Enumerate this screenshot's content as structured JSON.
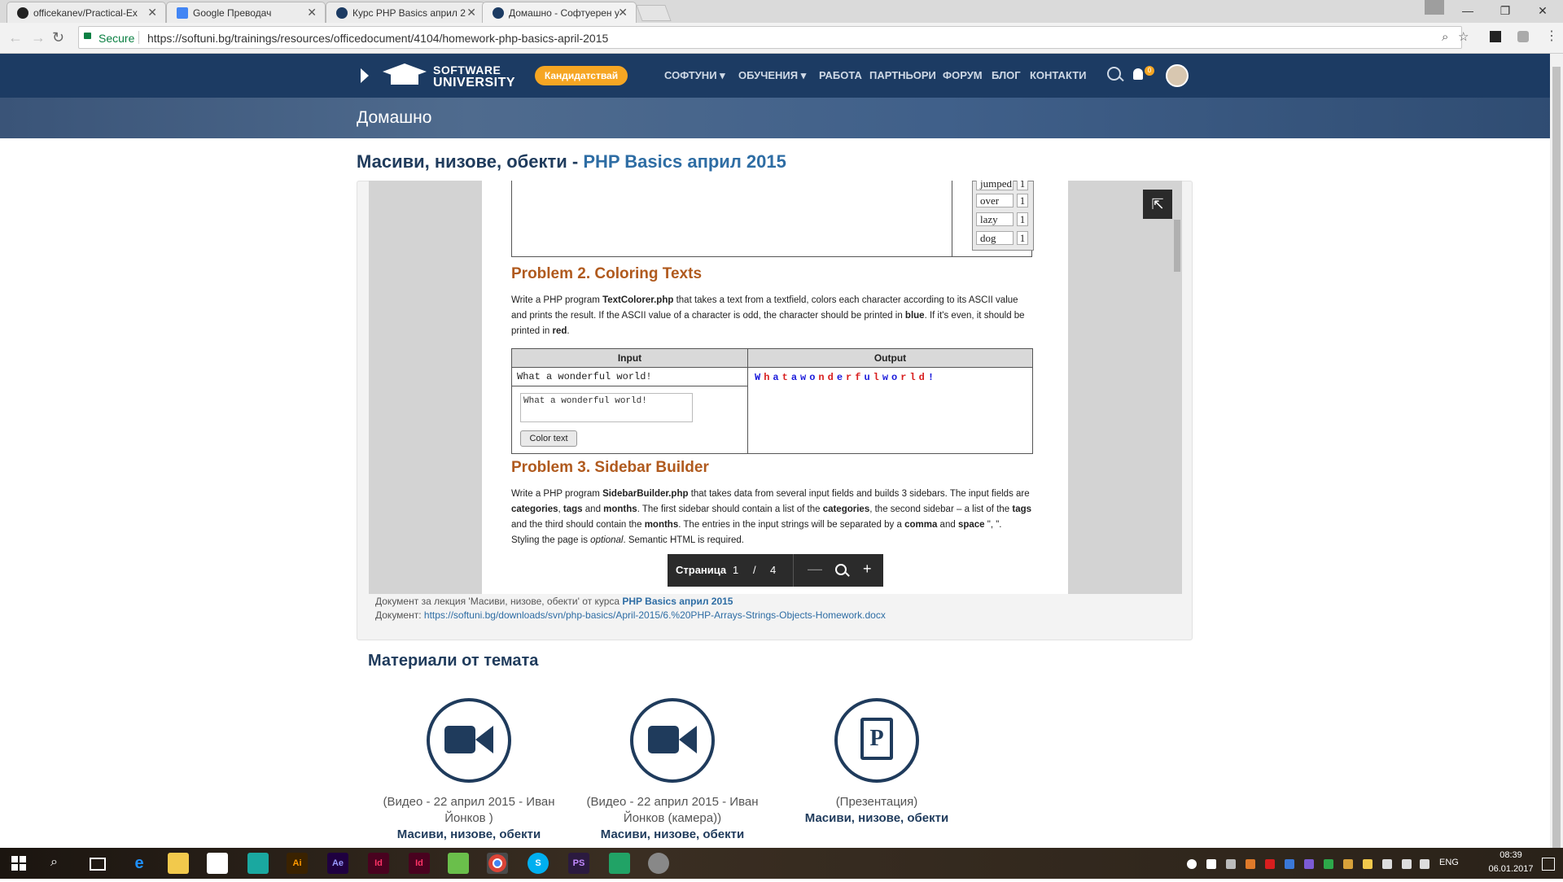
{
  "browser": {
    "tabs": [
      {
        "title": "officekanev/Practical-Ex",
        "icon_color": "#222222"
      },
      {
        "title": "Google Преводач",
        "icon_color": "#4285f4"
      },
      {
        "title": "Курс PHP Basics април 2",
        "icon_color": "#1c3b63"
      },
      {
        "title": "Домашно - Софтуерен у",
        "icon_color": "#1c3b63"
      }
    ],
    "secure_label": "Secure",
    "url": "https://softuni.bg/trainings/resources/officedocument/4104/homework-php-basics-april-2015"
  },
  "site": {
    "logo_line1": "SOFTWARE",
    "logo_line2": "UNIVERSITY",
    "apply_label": "Кандидатствай",
    "nav": [
      "СОФТУНИ",
      "ОБУЧЕНИЯ",
      "РАБОТА",
      "ПАРТНЬОРИ",
      "ФОРУМ",
      "БЛОГ",
      "КОНТАКТИ"
    ],
    "notification_count": "0",
    "hero_title": "Домашно",
    "brand_color": "#1c3b63",
    "accent_color": "#f6a623"
  },
  "heading": {
    "prefix": "Масиви, низове, обекти - ",
    "course": "PHP Basics април 2015"
  },
  "document": {
    "word_table": [
      {
        "word": "jumped",
        "count": "1"
      },
      {
        "word": "over",
        "count": "1"
      },
      {
        "word": "lazy",
        "count": "1"
      },
      {
        "word": "dog",
        "count": "1"
      }
    ],
    "problem2_title": "Problem 2.   Coloring Texts",
    "problem2_text_html": "Write a PHP program <b>TextColorer.php</b> that takes a text from a textfield, colors each character according to its ASCII value and prints the result. If the ASCII value of a character is odd, the character should be printed in <b>blue</b>. If it's even, it should be printed in <b>red</b>.",
    "io_input_header": "Input",
    "io_output_header": "Output",
    "io_input_value": "What a wonderful world!",
    "io_textarea_value": "What a wonderful world!",
    "io_button_label": "Color text",
    "io_output_chars": [
      {
        "ch": "W",
        "color": "#1a1adb"
      },
      {
        "ch": "h",
        "color": "#d81e1e"
      },
      {
        "ch": "a",
        "color": "#1a1adb"
      },
      {
        "ch": "t",
        "color": "#d81e1e"
      },
      {
        "ch": "a",
        "color": "#1a1adb"
      },
      {
        "ch": "w",
        "color": "#1a1adb"
      },
      {
        "ch": "o",
        "color": "#1a1adb"
      },
      {
        "ch": "n",
        "color": "#d81e1e"
      },
      {
        "ch": "d",
        "color": "#d81e1e"
      },
      {
        "ch": "e",
        "color": "#1a1adb"
      },
      {
        "ch": "r",
        "color": "#d81e1e"
      },
      {
        "ch": "f",
        "color": "#d81e1e"
      },
      {
        "ch": "u",
        "color": "#1a1adb"
      },
      {
        "ch": "l",
        "color": "#d81e1e"
      },
      {
        "ch": "w",
        "color": "#1a1adb"
      },
      {
        "ch": "o",
        "color": "#1a1adb"
      },
      {
        "ch": "r",
        "color": "#d81e1e"
      },
      {
        "ch": "l",
        "color": "#d81e1e"
      },
      {
        "ch": "d",
        "color": "#d81e1e"
      },
      {
        "ch": "!",
        "color": "#1a1adb"
      }
    ],
    "problem3_title": "Problem 3.   Sidebar Builder",
    "problem3_text_html": "Write a PHP program <b>SidebarBuilder.php</b> that takes data from several input fields and builds 3 sidebars. The input fields are <b>categories</b>, <b>tags</b> and <b>months</b>. The first sidebar should contain a list of the <b>categories</b>, the second sidebar – a list of the <b>tags</b> and the third should contain the <b>months</b>. The entries in the input strings will be separated by a <b>comma</b> and <b>space</b> \", \". Styling the page is <i>optional</i>. Semantic HTML is required."
  },
  "pager": {
    "label": "Страница",
    "current": "1",
    "separator": "/",
    "total": "4"
  },
  "caption": {
    "lecture_prefix": "Документ за лекция 'Масиви, низове, обекти' от курса ",
    "lecture_course": "PHP Basics април 2015",
    "doc_prefix": "Документ: ",
    "doc_url": "https://softuni.bg/downloads/svn/php-basics/April-2015/6.%20PHP-Arrays-Strings-Objects-Homework.docx"
  },
  "materials": {
    "heading": "Материали от темата",
    "items": [
      {
        "icon": "video-camera-icon",
        "desc": "(Видео - 22 април 2015 - Иван Йонков )",
        "title": "Масиви, низове, обекти"
      },
      {
        "icon": "video-camera-icon",
        "desc": "(Видео - 22 април 2015 - Иван Йонков (камера))",
        "title": "Масиви, низове, обекти"
      },
      {
        "icon": "presentation-icon",
        "desc": "(Презентация)",
        "title": "Масиви, низове, обекти"
      }
    ]
  },
  "taskbar": {
    "lang": "ENG",
    "time": "08:39",
    "date": "06.01.2017"
  }
}
